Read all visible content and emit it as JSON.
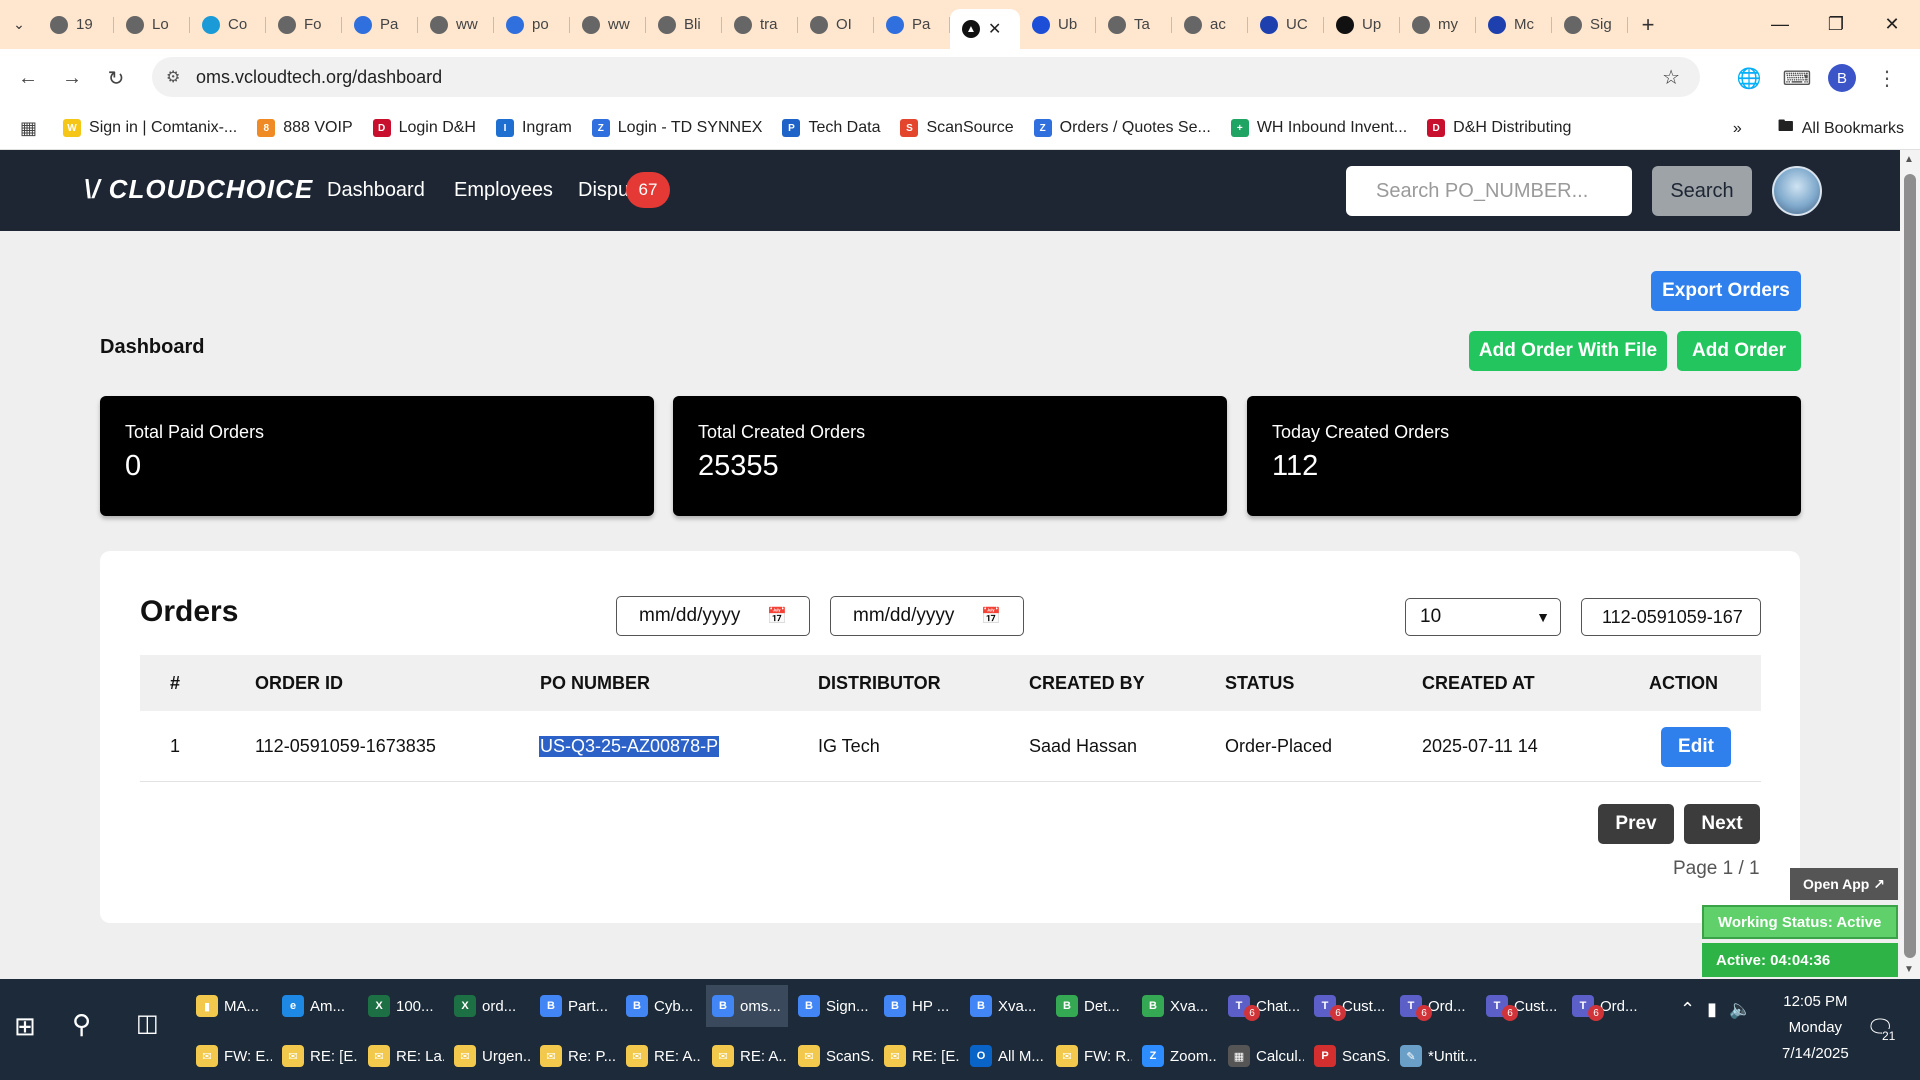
{
  "browser": {
    "tabs": [
      {
        "label": "19",
        "fav": "globe-icon",
        "color": "#666"
      },
      {
        "label": "Lo",
        "fav": "globe-icon",
        "color": "#666"
      },
      {
        "label": "Co",
        "fav": "logi-icon",
        "color": "#1a9bd7"
      },
      {
        "label": "Fo",
        "fav": "globe-icon",
        "color": "#666"
      },
      {
        "label": "Pa",
        "fav": "arrow-icon",
        "color": "#2f6fde"
      },
      {
        "label": "ww",
        "fav": "globe-icon",
        "color": "#666"
      },
      {
        "label": "po",
        "fav": "feather-icon",
        "color": "#2f6fde"
      },
      {
        "label": "ww",
        "fav": "globe-icon",
        "color": "#666"
      },
      {
        "label": "Bli",
        "fav": "globe-icon",
        "color": "#666"
      },
      {
        "label": "tra",
        "fav": "globe-icon",
        "color": "#666"
      },
      {
        "label": "OI",
        "fav": "globe-icon",
        "color": "#666"
      },
      {
        "label": "Pa",
        "fav": "cloud-icon",
        "color": "#2f6fde"
      }
    ],
    "active_tab": {
      "fav": "vcloud-icon"
    },
    "tabs_after": [
      {
        "label": "Ub",
        "fav": "u-icon",
        "color": "#1d4ed8"
      },
      {
        "label": "Ta",
        "fav": "globe-icon",
        "color": "#666"
      },
      {
        "label": "ac",
        "fav": "globe-icon",
        "color": "#666"
      },
      {
        "label": "UC",
        "fav": "ingram-icon",
        "color": "#1e40af"
      },
      {
        "label": "Up",
        "fav": "check-icon",
        "color": "#111"
      },
      {
        "label": "my",
        "fav": "globe-icon",
        "color": "#666"
      },
      {
        "label": "Mc",
        "fav": "etn-icon",
        "color": "#1e40af"
      },
      {
        "label": "Sig",
        "fav": "globe-icon",
        "color": "#666"
      }
    ],
    "url": "oms.vcloudtech.org/dashboard",
    "profile_initial": "B",
    "bookmarks": [
      {
        "label": "Sign in | Comtanix-...",
        "color": "#f5c518",
        "glyph": "W"
      },
      {
        "label": "888 VOIP",
        "color": "#f08a24",
        "glyph": "8"
      },
      {
        "label": "Login D&H",
        "color": "#c8102e",
        "glyph": "D"
      },
      {
        "label": "Ingram",
        "color": "#1f6fd1",
        "glyph": "I"
      },
      {
        "label": "Login - TD SYNNEX",
        "color": "#2f6fde",
        "glyph": "Z"
      },
      {
        "label": "Tech Data",
        "color": "#1e63c7",
        "glyph": "P"
      },
      {
        "label": "ScanSource",
        "color": "#e4462d",
        "glyph": "S"
      },
      {
        "label": "Orders / Quotes Se...",
        "color": "#2f6fde",
        "glyph": "Z"
      },
      {
        "label": "WH Inbound Invent...",
        "color": "#1fa463",
        "glyph": "+"
      },
      {
        "label": "D&H Distributing",
        "color": "#c8102e",
        "glyph": "D"
      }
    ],
    "more_label": "»",
    "all_bookmarks": "All Bookmarks"
  },
  "app": {
    "logo": "\\/ CLOUDCHOICE",
    "nav": {
      "dashboard": "Dashboard",
      "employees": "Employees",
      "disputes": "Dispu"
    },
    "disputes_badge": "67",
    "search_placeholder": "Search PO_NUMBER...",
    "search_button": "Search",
    "export_button": "Export Orders",
    "add_with_file_button": "Add Order With File",
    "add_button": "Add Order",
    "page_title": "Dashboard",
    "stats": {
      "paid": {
        "label": "Total Paid Orders",
        "value": "0"
      },
      "created": {
        "label": "Total Created Orders",
        "value": "25355"
      },
      "today": {
        "label": "Today Created Orders",
        "value": "112"
      }
    },
    "orders": {
      "title": "Orders",
      "date_from": "mm/dd/yyyy",
      "date_to": "mm/dd/yyyy",
      "page_size": "10",
      "filter_value": "112-0591059-167",
      "columns": {
        "num": "#",
        "order_id": "ORDER ID",
        "po": "PO NUMBER",
        "distributor": "DISTRIBUTOR",
        "created_by": "CREATED BY",
        "status": "STATUS",
        "created_at": "CREATED AT",
        "action": "ACTION"
      },
      "rows": [
        {
          "num": "1",
          "order_id": "112-0591059-1673835",
          "po": "US-Q3-25-AZ00878-P",
          "distributor": "IG Tech",
          "created_by": "Saad Hassan",
          "status": "Order-Placed",
          "created_at": "2025-07-11 14",
          "action": "Edit"
        }
      ],
      "prev": "Prev",
      "next": "Next",
      "page_info": "Page 1 / 1"
    }
  },
  "widget": {
    "open_app": "Open App ↗",
    "status": "Working Status: Active",
    "timer": "Active: 04:04:36"
  },
  "taskbar": {
    "row1": [
      {
        "label": "MA...",
        "color": "#f2c94c",
        "glyph": "▮"
      },
      {
        "label": "Am...",
        "color": "#1e88e5",
        "glyph": "e"
      },
      {
        "label": "100...",
        "color": "#1d7044",
        "glyph": "X"
      },
      {
        "label": "ord...",
        "color": "#1d7044",
        "glyph": "X"
      },
      {
        "label": "Part...",
        "color": "#4285f4",
        "glyph": "B"
      },
      {
        "label": "Cyb...",
        "color": "#4285f4",
        "glyph": "B"
      },
      {
        "label": "oms...",
        "color": "#4285f4",
        "glyph": "B",
        "active": true
      },
      {
        "label": "Sign...",
        "color": "#4285f4",
        "glyph": "B"
      },
      {
        "label": "HP ...",
        "color": "#4285f4",
        "glyph": "B"
      },
      {
        "label": "Xva...",
        "color": "#4285f4",
        "glyph": "B"
      },
      {
        "label": "Det...",
        "color": "#34a853",
        "glyph": "B"
      },
      {
        "label": "Xva...",
        "color": "#34a853",
        "glyph": "B"
      },
      {
        "label": "Chat...",
        "color": "#5b5fc7",
        "glyph": "T",
        "count": "6"
      },
      {
        "label": "Cust...",
        "color": "#5b5fc7",
        "glyph": "T",
        "count": "6"
      },
      {
        "label": "Ord...",
        "color": "#5b5fc7",
        "glyph": "T",
        "count": "6"
      },
      {
        "label": "Cust...",
        "color": "#5b5fc7",
        "glyph": "T",
        "count": "6"
      },
      {
        "label": "Ord...",
        "color": "#5b5fc7",
        "glyph": "T",
        "count": "6"
      }
    ],
    "row2": [
      {
        "label": "FW: E...",
        "color": "#f2c94c",
        "glyph": "✉"
      },
      {
        "label": "RE: [E...",
        "color": "#f2c94c",
        "glyph": "✉"
      },
      {
        "label": "RE: La...",
        "color": "#f2c94c",
        "glyph": "✉"
      },
      {
        "label": "Urgen...",
        "color": "#f2c94c",
        "glyph": "✉"
      },
      {
        "label": "Re: P...",
        "color": "#f2c94c",
        "glyph": "✉"
      },
      {
        "label": "RE: A...",
        "color": "#f2c94c",
        "glyph": "✉"
      },
      {
        "label": "RE: A...",
        "color": "#f2c94c",
        "glyph": "✉"
      },
      {
        "label": "ScanS...",
        "color": "#f2c94c",
        "glyph": "✉"
      },
      {
        "label": "RE: [E...",
        "color": "#f2c94c",
        "glyph": "✉"
      },
      {
        "label": "All M...",
        "color": "#0a64c8",
        "glyph": "O"
      },
      {
        "label": "FW: R...",
        "color": "#f2c94c",
        "glyph": "✉"
      },
      {
        "label": "Zoom...",
        "color": "#2d8cff",
        "glyph": "Z"
      },
      {
        "label": "Calcul...",
        "color": "#555",
        "glyph": "▦"
      },
      {
        "label": "ScanS...",
        "color": "#d32f2f",
        "glyph": "P"
      },
      {
        "label": "*Untit...",
        "color": "#6aa0c8",
        "glyph": "✎"
      }
    ],
    "time": "12:05 PM",
    "day": "Monday",
    "date": "7/14/2025",
    "notifications": "21"
  }
}
